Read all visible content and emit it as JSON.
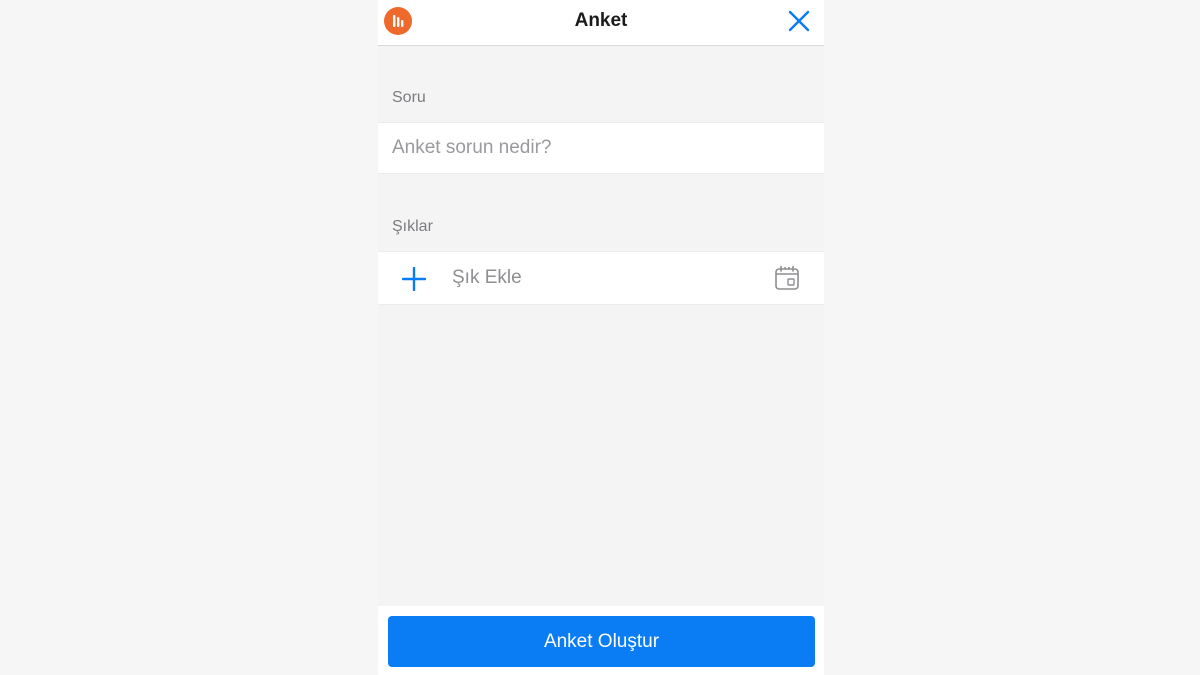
{
  "header": {
    "title": "Anket",
    "app_icon": "poll-app-icon",
    "close_icon": "close-icon",
    "accent_color": "#ee6a2c"
  },
  "question": {
    "label": "Soru",
    "value": "",
    "placeholder": "Anket sorun nedir?"
  },
  "options": {
    "label": "Şıklar",
    "add_label": "Şık Ekle",
    "add_icon": "plus-icon",
    "date_icon": "calendar-icon"
  },
  "footer": {
    "create_label": "Anket Oluştur",
    "button_color": "#0a7cf4"
  }
}
